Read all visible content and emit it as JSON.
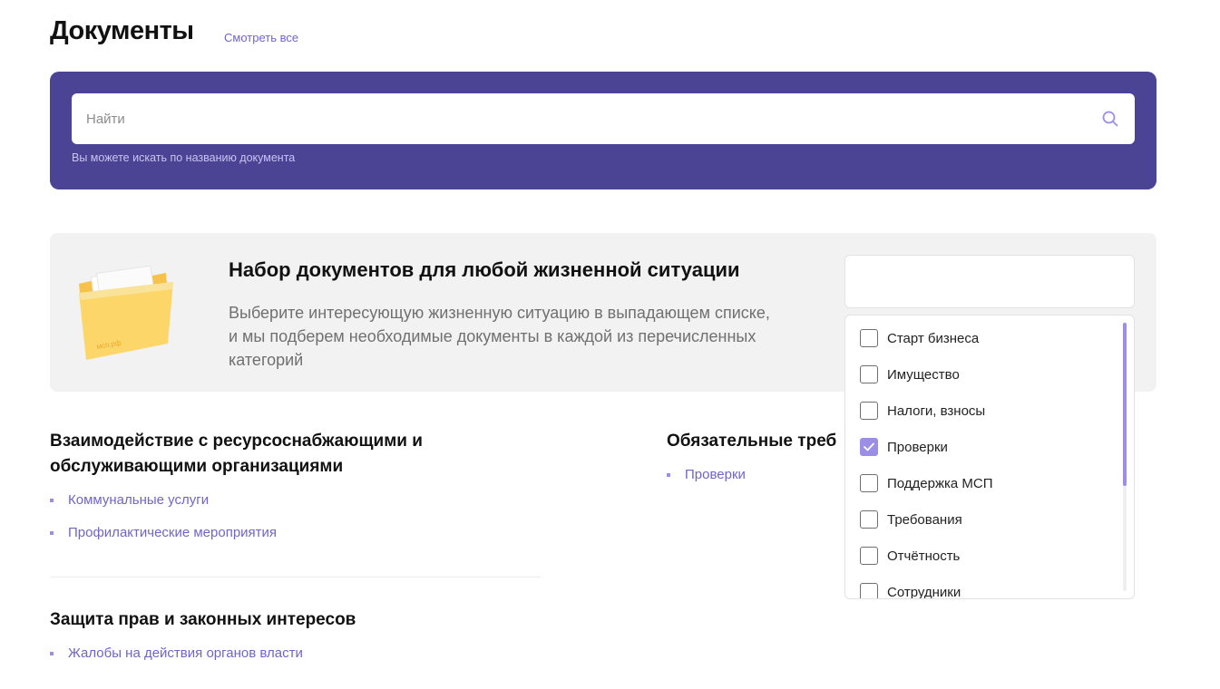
{
  "header": {
    "title": "Документы",
    "see_all": "Смотреть все"
  },
  "search": {
    "placeholder": "Найти",
    "value": "",
    "hint": "Вы можете искать по названию документа",
    "icon": "search-icon"
  },
  "promo": {
    "title": "Набор документов для любой жизненной ситуации",
    "text": "Выберите интересующую жизненную ситуацию в выпадающем списке, и мы подберем необходимые документы в каждой из перечисленных категорий",
    "folder_label": "мсп.рф",
    "select_value": ""
  },
  "dropdown": {
    "items": [
      {
        "label": "Старт бизнеса",
        "checked": false
      },
      {
        "label": "Имущество",
        "checked": false
      },
      {
        "label": "Налоги, взносы",
        "checked": false
      },
      {
        "label": "Проверки",
        "checked": true
      },
      {
        "label": "Поддержка МСП",
        "checked": false
      },
      {
        "label": "Требования",
        "checked": false
      },
      {
        "label": "Отчётность",
        "checked": false
      },
      {
        "label": "Сотрудники",
        "checked": false
      }
    ]
  },
  "categories": {
    "resource": {
      "title_line1": "Взаимодействие с ресурсоснабжающими и",
      "title_line2": "обслуживающими организациями",
      "links": [
        "Коммунальные услуги",
        "Профилактические мероприятия"
      ]
    },
    "mandatory": {
      "title": "Обязательные треб",
      "links": [
        "Проверки"
      ]
    },
    "rights": {
      "title": "Защита прав и законных интересов",
      "links": [
        "Жалобы на действия органов власти"
      ]
    }
  },
  "colors": {
    "accent": "#6f65c8",
    "panel": "#4b4495",
    "checkbox_checked": "#9b8ee6"
  }
}
